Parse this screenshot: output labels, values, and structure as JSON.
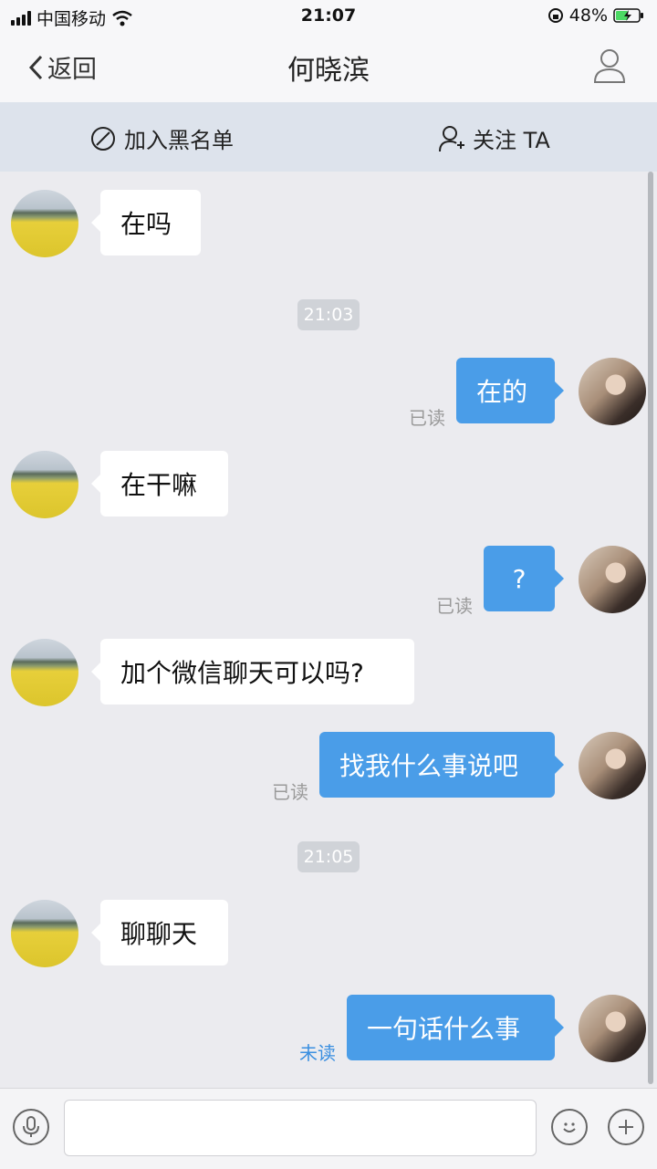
{
  "status": {
    "carrier": "中国移动",
    "time": "21:07",
    "battery": "48%"
  },
  "nav": {
    "back_label": "返回",
    "title": "何晓滨"
  },
  "actions": {
    "block_label": "加入黑名单",
    "follow_label": "关注 TA"
  },
  "messages": [
    {
      "side": "in",
      "text": "在吗"
    },
    {
      "type": "time",
      "text": "21:03"
    },
    {
      "side": "out",
      "text": "在的",
      "status": "已读"
    },
    {
      "side": "in",
      "text": "在干嘛"
    },
    {
      "side": "out",
      "text": "?",
      "status": "已读"
    },
    {
      "side": "in",
      "text": "加个微信聊天可以吗?"
    },
    {
      "side": "out",
      "text": "找我什么事说吧",
      "status": "已读"
    },
    {
      "type": "time",
      "text": "21:05"
    },
    {
      "side": "in",
      "text": "聊聊天"
    },
    {
      "side": "out",
      "text": "一句话什么事",
      "status": "未读"
    }
  ],
  "input": {
    "placeholder": ""
  },
  "colors": {
    "outgoing_bubble": "#4a9de8",
    "incoming_bubble": "#ffffff",
    "unread": "#3a8fe0",
    "read": "#9a9a9a",
    "background": "#ebebef"
  }
}
